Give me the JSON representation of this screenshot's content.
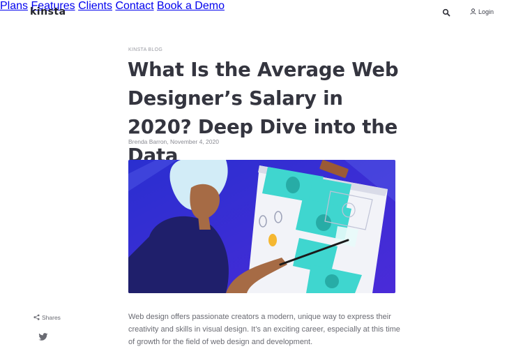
{
  "header": {
    "logo_text": "kinsta",
    "nav": [
      "Plans",
      "Features",
      "Clients",
      "Contact",
      "Book a Demo"
    ],
    "search_icon": "search-icon",
    "login_label": "Login",
    "login_icon": "user-icon"
  },
  "article": {
    "kicker": "KINSTA BLOG",
    "title": "What Is the Average Web Designer’s Salary in 2020? Deep Dive into the Data",
    "byline": "Brenda Barron, November 4, 2020",
    "intro": "Web design offers passionate creators a modern, unique way to express their creativity and skills in visual design. It’s an exciting career, especially at this time of growth for the field of web design and development."
  },
  "social": {
    "shares_label": "Shares",
    "share_icon": "share-icon",
    "twitter_icon": "twitter-icon"
  },
  "colors": {
    "hero_bg": "#3a2fd6",
    "banknote": "#3fd6cf",
    "text_dark": "#34353f"
  }
}
